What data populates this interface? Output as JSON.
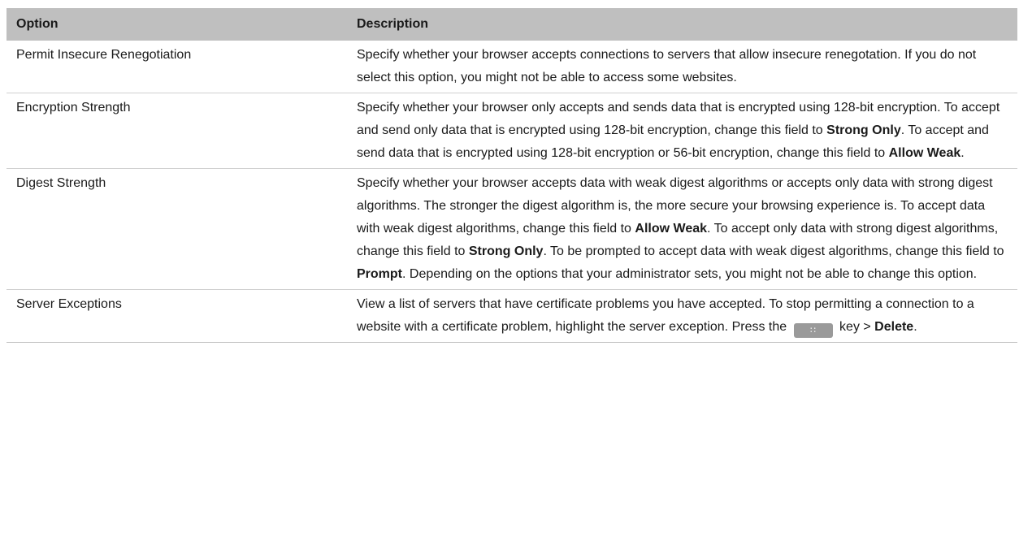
{
  "table": {
    "headers": {
      "option": "Option",
      "description": "Description"
    },
    "rows": [
      {
        "option": "Permit Insecure Renegotiation",
        "description": "Specify whether your browser accepts connections to servers that allow insecure renegotation. If you do not select this option, you might not be able to access some websites."
      },
      {
        "option": "Encryption Strength",
        "d1": "Specify whether your browser only accepts and sends data that is encrypted using 128-bit encryption. To accept and send only data that is encrypted using 128-bit encryption, change this field to ",
        "b1": "Strong Only",
        "d2": ". To accept and send data that is encrypted using 128-bit encryption or 56-bit encryption, change this field to ",
        "b2": "Allow Weak",
        "d3": "."
      },
      {
        "option": "Digest Strength",
        "d1": "Specify whether your browser accepts data with weak digest algorithms or accepts only data with strong digest algorithms. The stronger the digest algorithm is, the more secure your browsing experience is. To accept data with weak digest algorithms, change this field to ",
        "b1": "Allow Weak",
        "d2": ". To accept only data with strong digest algorithms, change this field to ",
        "b2": "Strong Only",
        "d3": ". To be prompted to accept data with weak digest algorithms, change this field to ",
        "b3": "Prompt",
        "d4": ". Depending on the options that your administrator sets, you might not be able to change this option."
      },
      {
        "option": "Server Exceptions",
        "d1": "View a list of servers that have certificate problems you have accepted. To stop permitting a connection to a website with a certificate problem, highlight the server exception. Press the ",
        "key_icon": "blackberry-menu-key-icon",
        "d2": " key > ",
        "b1": "Delete",
        "d3": "."
      }
    ]
  },
  "colors": {
    "header_bg": "#bfbfbf",
    "row_border": "#d0d0d0",
    "key_bg": "#9a9a9a"
  }
}
